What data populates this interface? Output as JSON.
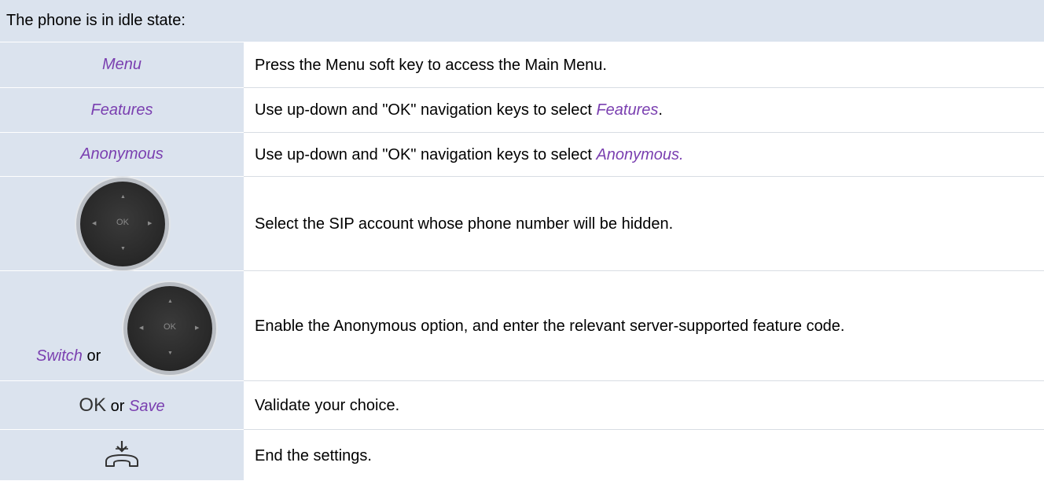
{
  "header": {
    "text": "The phone is in idle state:"
  },
  "rows": [
    {
      "left": "Menu",
      "right": "Press the Menu soft key to access the Main Menu."
    },
    {
      "left": "Features",
      "right_prefix": "Use up-down and \"OK\" navigation keys to select ",
      "right_em": "Features",
      "right_suffix": "."
    },
    {
      "left": "Anonymous",
      "right_prefix": "Use up-down and \"OK\" navigation keys to select ",
      "right_em": "Anonymous.",
      "right_suffix": ""
    },
    {
      "icon": "navigation-key-icon",
      "key_label": "OK",
      "right": "Select the SIP account whose phone number will be hidden."
    },
    {
      "left_em": "Switch",
      "left_sep": " or",
      "icon": "navigation-key-icon",
      "key_label": "OK",
      "right": "Enable the Anonymous option, and enter the relevant server-supported feature code."
    },
    {
      "left_ok": "OK",
      "left_sep": " or ",
      "left_em": "Save",
      "right": "Validate your choice."
    },
    {
      "icon": "hang-up-icon",
      "right": "End the settings."
    }
  ],
  "colors": {
    "header_bg": "#dbe3ee",
    "accent": "#7a3fb0"
  }
}
